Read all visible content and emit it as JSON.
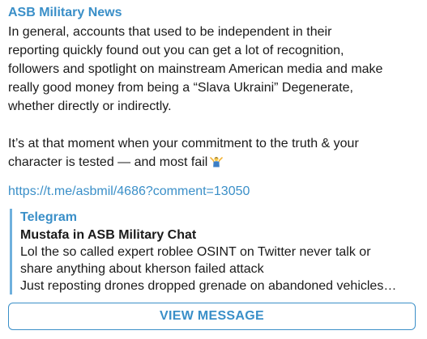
{
  "channel": {
    "name": "ASB Military News"
  },
  "message": {
    "paragraph1_line1": "In general, accounts that used to be independent in their",
    "paragraph1_line2": "reporting quickly found out you can get a lot of recognition,",
    "paragraph1_line3": "followers and spotlight on mainstream American media and make",
    "paragraph1_line4": "really good money from being a “Slava Ukraini” Degenerate,",
    "paragraph1_line5": "whether directly or indirectly.",
    "paragraph2_line1": "It’s at that moment when your commitment to the truth & your",
    "paragraph2_line2": "character is tested — and most fail",
    "emoji": "person-shrugging-icon",
    "link": "https://t.me/asbmil/4686?comment=13050"
  },
  "preview": {
    "site": "Telegram",
    "title": "Mustafa in ASB Military Chat",
    "desc_line1": "Lol the so called expert roblee OSINT on Twitter never talk or",
    "desc_line2": "share anything about kherson failed attack",
    "desc_line3": "Just reposting drones dropped grenade on abandoned vehicles…"
  },
  "button": {
    "label": "VIEW MESSAGE"
  },
  "colors": {
    "accent": "#3a8fc8",
    "text": "#1a1a1a",
    "preview_bar": "#6fb0dd"
  }
}
